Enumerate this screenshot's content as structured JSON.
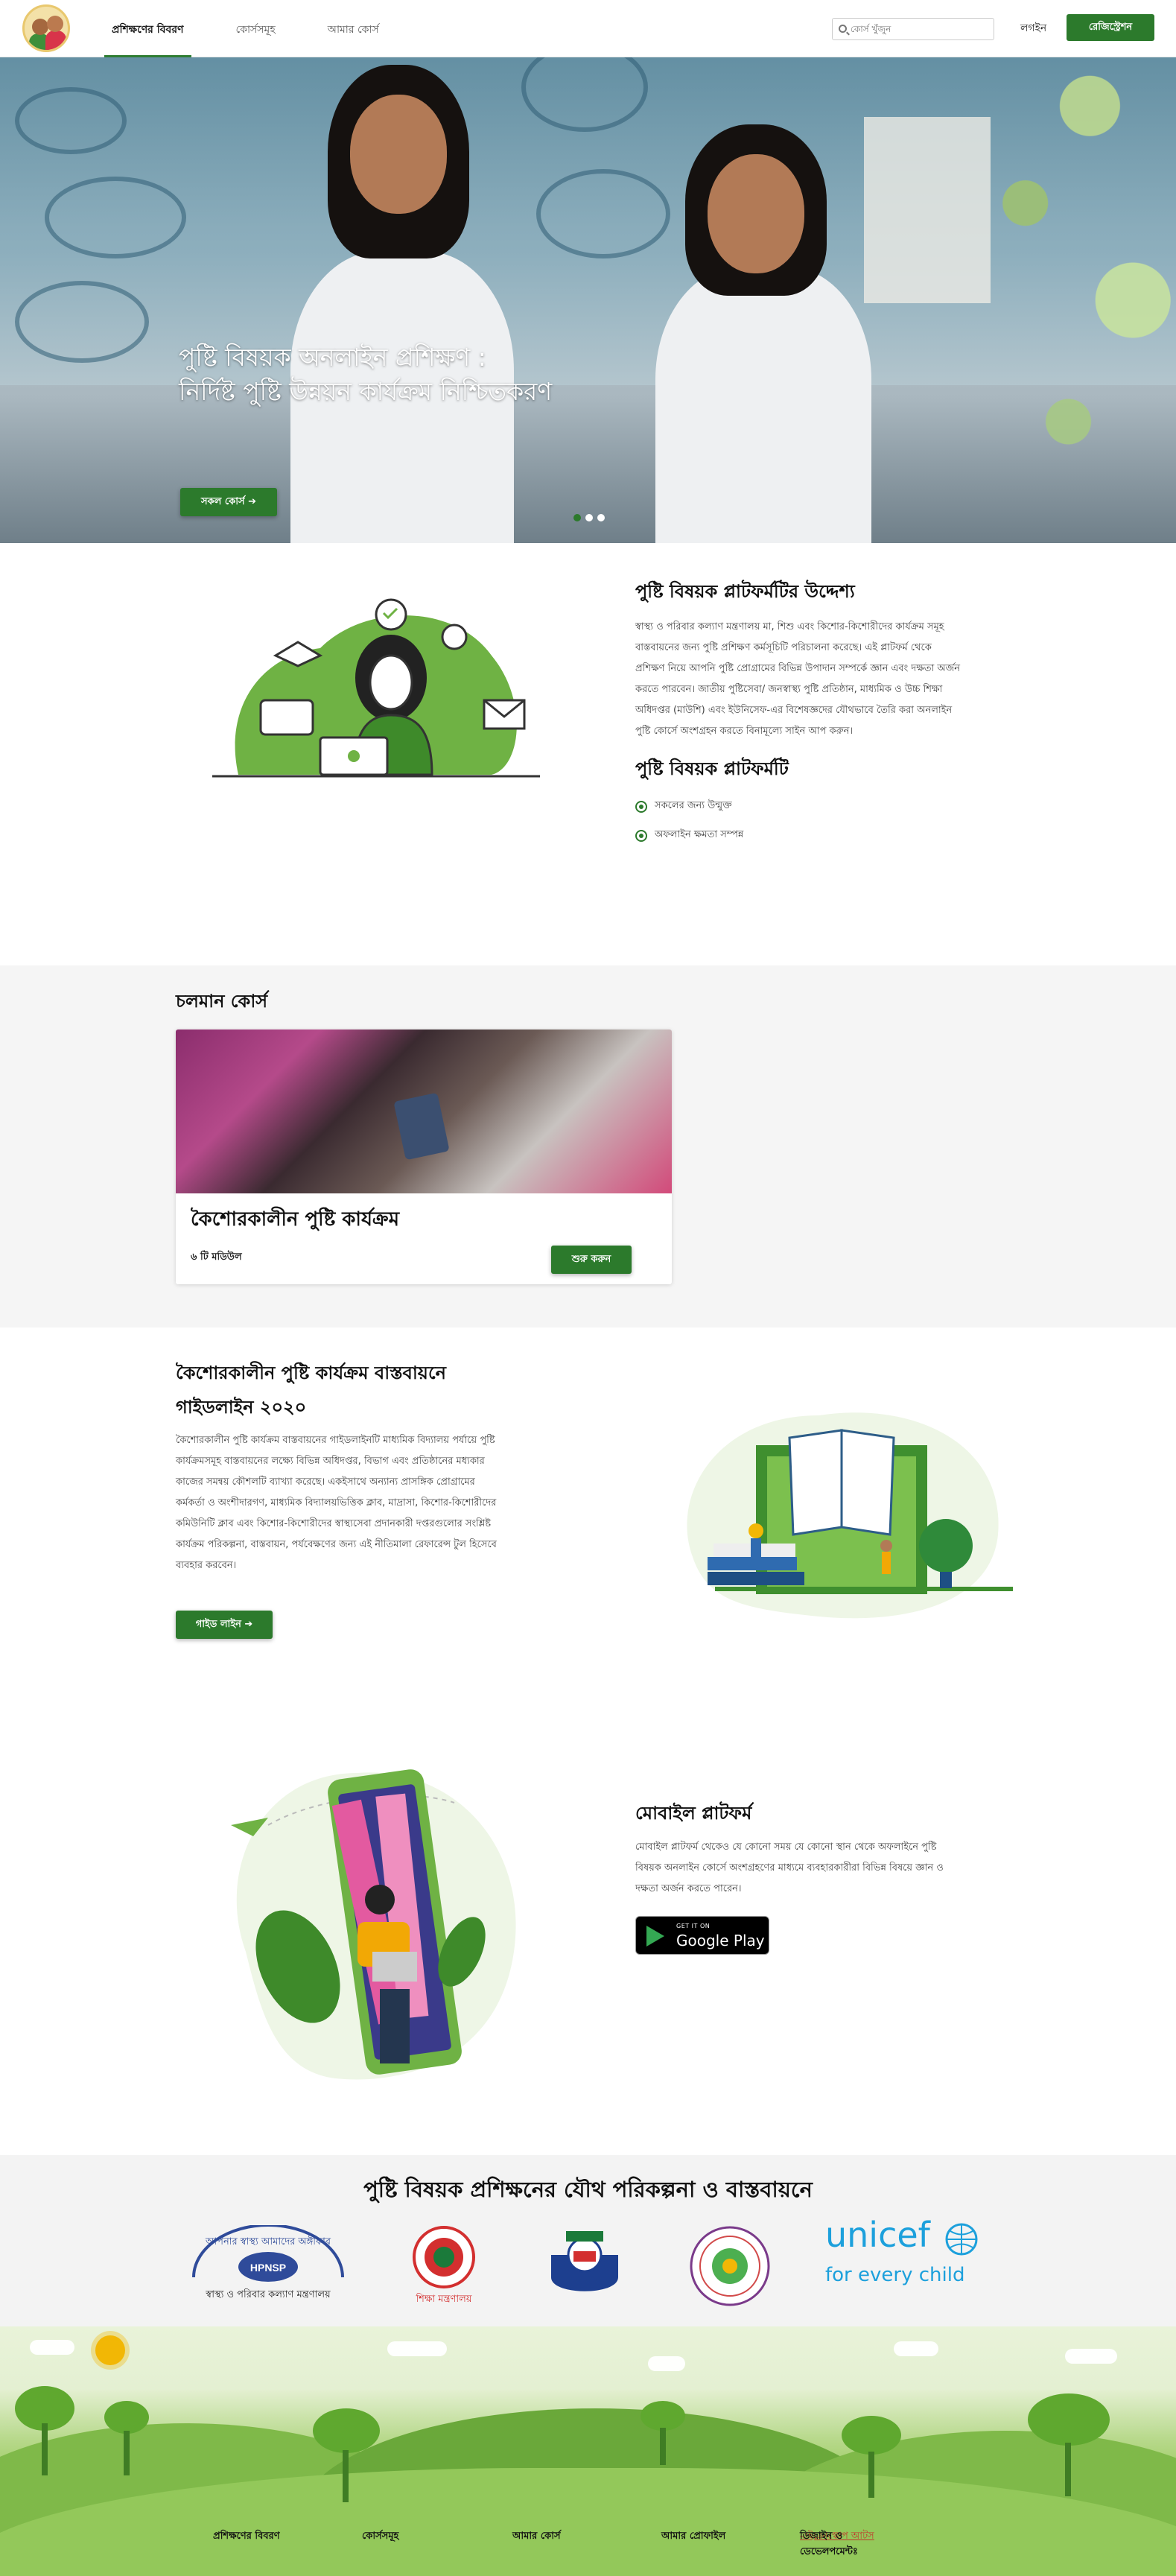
{
  "header": {
    "nav": [
      "প্রশিক্ষণের বিবরণ",
      "কোর্সসমূহ",
      "আমার কোর্স"
    ],
    "search_placeholder": "কোর্স খুঁজুন",
    "login": "লগইন",
    "register": "রেজিস্ট্রেশন"
  },
  "hero": {
    "title_line1": "পুষ্টি বিষয়ক অনলাইন প্রশিক্ষণ :",
    "title_line2": "নির্দিষ্ট পুষ্টি উন্নয়ন কার্যক্রম নিশ্চিতকরণ",
    "button": "সকল কোর্স ➔",
    "slides": 3,
    "active_slide": 1
  },
  "about": {
    "title": "পুষ্টি বিষয়ক প্লাটফর্মটির উদ্দেশ্য",
    "body": "স্বাস্থ্য ও পরিবার কল্যাণ মন্ত্রণালয় মা, শিশু এবং কিশোর-কিশোরীদের কার্যক্রম সমূহ বাস্তবায়নের জন্য পুষ্টি প্রশিক্ষণ কর্মসূচিটি পরিচালনা করেছে। এই প্লাটফর্ম থেকে প্রশিক্ষণ নিয়ে আপনি পুষ্টি প্রোগ্রামের বিভিন্ন উপাদান সম্পর্কে জ্ঞান এবং দক্ষতা অর্জন করতে পারবেন। জাতীয় পুষ্টিসেবা/ জনস্বাস্থ্য পুষ্টি প্রতিষ্ঠান, মাধ্যমিক ও উচ্চ শিক্ষা অধিদপ্তর (মাউশি) এবং ইউনিসেফ-এর বিশেষজ্ঞদের যৌথভাবে তৈরি করা অনলাইন পুষ্টি কোর্সে অংশগ্রহন করতে বিনামূল্যে সাইন আপ করুন।",
    "subtitle": "পুষ্টি বিষয়ক প্লাটফর্মটি",
    "features": [
      "সকলের জন্য উন্মুক্ত",
      "অফলাইন ক্ষমতা সম্পন্ন"
    ]
  },
  "running": {
    "title": "চলমান কোর্স",
    "course": {
      "title": "কৈশোরকালীন পুষ্টি কার্যক্রম",
      "modules": "৬ টি মডিউল",
      "button": "শুরু করুন"
    }
  },
  "guide": {
    "title": "কৈশোরকালীন পুষ্টি কার্যক্রম বাস্তবায়নে গাইডলাইন ২০২০",
    "body": "কৈশোরকালীন পুষ্টি কার্যক্রম বাস্তবায়নের গাইডলাইনটি মাধ্যমিক বিদ্যালয় পর্যায়ে পুষ্টি কার্যক্রমসমূহ বাস্তবায়নের লক্ষ্যে বিভিন্ন অধিদপ্তর, বিভাগ এবং প্রতিষ্ঠানের মধ্যকার কাজের সমন্বয় কৌশলটি ব্যাখ্যা করেছে। একইসাথে অন্যান্য প্রাসঙ্গিক প্রোগ্রামের কর্মকর্তা ও অংশীদারগণ, মাধ্যমিক বিদ্যালয়ভিত্তিক ক্লাব, মাদ্রাসা, কিশোর-কিশোরীদের কমিউনিটি ক্লাব এবং কিশোর-কিশোরীদের স্বাস্থ্যসেবা প্রদানকারী দপ্তরগুলোর সংশ্লিষ্ট কার্যক্রম পরিকল্পনা, বাস্তবায়ন, পর্যবেক্ষণের জন্য এই নীতিমালা রেফারেন্স টুল হিসেবে ব্যবহার করবেন।",
    "button": "গাইড লাইন ➔"
  },
  "mobile": {
    "title": "মোবাইল প্লাটফর্ম",
    "body": "মোবাইল প্লাটফর্ম থেকেও যে কোনো সময় যে কোনো স্থান থেকে অফলাইনে পুষ্টি বিষয়ক অনলাইন কোর্সে অংশগ্রহণের মাধ্যমে ব্যবহারকারীরা বিভিন্ন বিষয়ে জ্ঞান ও দক্ষতা অর্জন করতে পারেন।",
    "store_small": "GET IT ON",
    "store_big": "Google Play"
  },
  "partners": {
    "title": "পুষ্টি বিষয়ক প্রশিক্ষনের যৌথ পরিকল্পনা ও বাস্তবায়নে",
    "logos": [
      {
        "top": "আপনার স্বাস্থ্য আমাদের অঙ্গীকার",
        "badge": "HPNSP",
        "caption": "স্বাস্থ্য ও পরিবার কল্যাণ মন্ত্রণালয়"
      },
      {
        "caption": "শিক্ষা মন্ত্রণালয়"
      },
      {
        "caption": ""
      },
      {
        "caption": ""
      },
      {
        "word": "unicef",
        "sub": "for every child"
      }
    ]
  },
  "footer": {
    "links": [
      "প্রশিক্ষণের বিবরণ",
      "কোর্সসমূহ",
      "আমার কোর্স",
      "আমার প্রোফাইল"
    ],
    "credit_prefix": "ডিজাইন ও ডেভেলপমেন্টঃ",
    "credit_link": "মাইক্রোস্কোপ আটস"
  },
  "colors": {
    "brand_green": "#2c7a2c",
    "unicef_blue": "#1ca0dc",
    "credit_red": "#c0392b"
  }
}
